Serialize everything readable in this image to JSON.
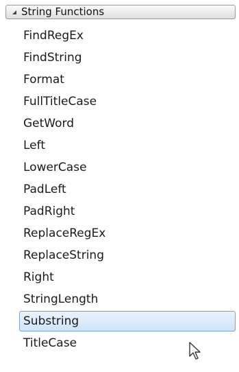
{
  "group": {
    "label": "String Functions",
    "expanded": true,
    "icon": "collapse-triangle-icon"
  },
  "items": [
    {
      "label": "FindRegEx"
    },
    {
      "label": "FindString"
    },
    {
      "label": "Format"
    },
    {
      "label": "FullTitleCase"
    },
    {
      "label": "GetWord"
    },
    {
      "label": "Left"
    },
    {
      "label": "LowerCase"
    },
    {
      "label": "PadLeft"
    },
    {
      "label": "PadRight"
    },
    {
      "label": "ReplaceRegEx"
    },
    {
      "label": "ReplaceString"
    },
    {
      "label": "Right"
    },
    {
      "label": "StringLength"
    },
    {
      "label": "Substring",
      "selected": true
    },
    {
      "label": "TitleCase"
    }
  ],
  "colors": {
    "selection_fill": "#cfe3f8",
    "selection_border": "#7da2ce",
    "header_border": "#9a9a9a"
  },
  "cursor": {
    "icon": "mouse-pointer-icon"
  }
}
